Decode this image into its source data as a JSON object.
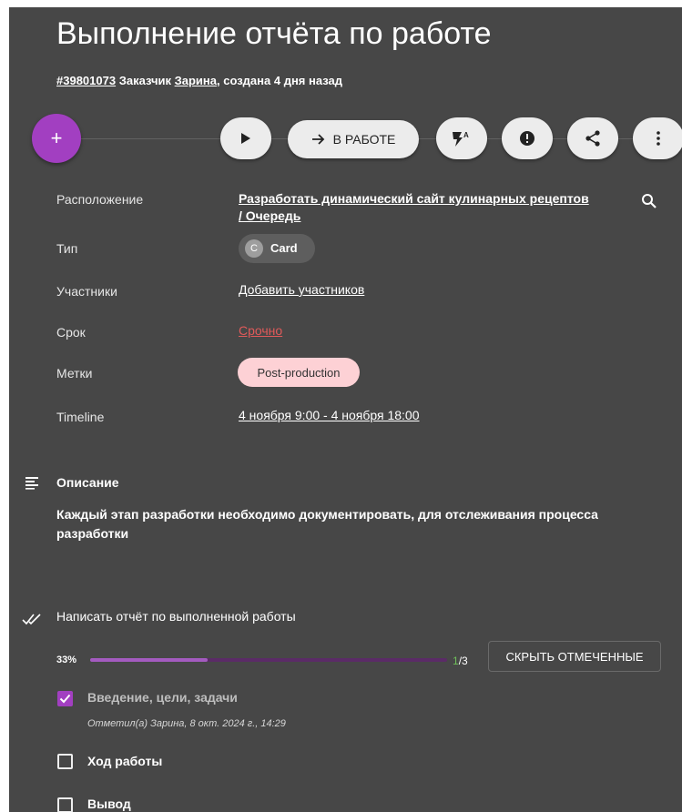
{
  "card": {
    "title": "Выполнение отчёта по работе",
    "id": "#39801073",
    "customer_prefix": "Заказчик",
    "customer_name": "Зарина",
    "created": ", создана 4 дня назад"
  },
  "toolbar": {
    "add_label": "+",
    "status_label": "В РАБОТЕ",
    "icons": [
      "add-icon",
      "play-icon",
      "arrow-right-icon",
      "flash-auto-icon",
      "alert-icon",
      "share-icon",
      "more-vert-icon"
    ]
  },
  "fields": {
    "location": {
      "label": "Расположение",
      "line1": "Разработать динамический сайт кулинарных рецептов",
      "line2": "/ Очередь"
    },
    "type": {
      "label": "Тип",
      "avatar_letter": "C",
      "value": "Card"
    },
    "members": {
      "label": "Участники",
      "value": "Добавить участников"
    },
    "due": {
      "label": "Срок",
      "value": "Срочно",
      "color": "#e05a5a"
    },
    "tags": {
      "label": "Метки",
      "value": "Post-production",
      "color": "#fdd1d5"
    },
    "timeline": {
      "label": "Timeline",
      "value": "4 ноября 9:00 - 4 ноября 18:00"
    }
  },
  "description": {
    "title": "Описание",
    "text": "Каждый этап разработки необходимо документировать, для отслеживания процесса разработки"
  },
  "checklist": {
    "title": "Написать отчёт по выполненной работы",
    "percent_label": "33%",
    "progress": 0.33,
    "done_count": "1",
    "total_count": "/3",
    "hide_button": "СКРЫТЬ ОТМЕЧЕННЫЕ",
    "items": [
      {
        "text": "Введение, цели, задачи",
        "checked": true,
        "meta": "Отметил(а) Зарина, 8 окт. 2024 г., 14:29"
      },
      {
        "text": "Ход работы",
        "checked": false
      },
      {
        "text": "Вывод",
        "checked": false
      }
    ]
  },
  "colors": {
    "background": "#474747",
    "accent": "#a23fc1",
    "progress": "#a45bc0"
  }
}
